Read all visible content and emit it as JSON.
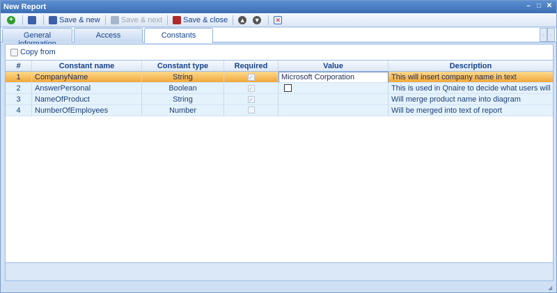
{
  "window": {
    "title": "New Report"
  },
  "toolbar": {
    "save_new_label": "Save & new",
    "save_next_label": "Save & next",
    "save_close_label": "Save & close"
  },
  "tabs": [
    {
      "label": "General information"
    },
    {
      "label": "Access"
    },
    {
      "label": "Constants"
    }
  ],
  "panel": {
    "copy_from_label": "Copy from"
  },
  "grid": {
    "headers": {
      "num": "#",
      "name": "Constant name",
      "type": "Constant type",
      "required": "Required",
      "value": "Value",
      "description": "Description"
    },
    "rows": [
      {
        "num": "1",
        "name": "CompanyName",
        "type": "String",
        "required": true,
        "value": "Microsoft Corporation",
        "description": "This will insert company name in text"
      },
      {
        "num": "2",
        "name": "AnswerPersonal",
        "type": "Boolean",
        "required": true,
        "value": "",
        "description": "This is used in Qnaire to decide what users will answ"
      },
      {
        "num": "3",
        "name": "NameOfProduct",
        "type": "String",
        "required": true,
        "value": "",
        "description": "Will merge product name into diagram"
      },
      {
        "num": "4",
        "name": "NumberOfEmployees",
        "type": "Number",
        "required": false,
        "value": "",
        "description": "Will be merged into text of report"
      }
    ]
  },
  "colors": {
    "selected_row": "#f2a73a",
    "row_bg": "#e4f2fb",
    "title_bar": "#3c6eb4"
  }
}
